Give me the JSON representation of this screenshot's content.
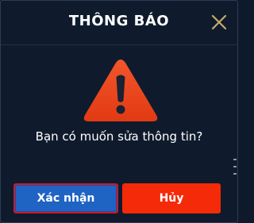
{
  "dialog": {
    "title": "THÔNG BÁO",
    "message": "Bạn có muốn sửa thông tin?",
    "close_icon": "close-icon",
    "warning_icon": "warning-triangle-icon"
  },
  "buttons": {
    "confirm_label": "Xác nhận",
    "cancel_label": "Hủy"
  },
  "colors": {
    "background": "#0f1b2d",
    "title_text": "#ffffff",
    "close_icon": "#c9a96a",
    "warning_fill": "#e8421c",
    "confirm_button": "#1f63c3",
    "confirm_border": "#d4162a",
    "cancel_button": "#f52a08"
  }
}
